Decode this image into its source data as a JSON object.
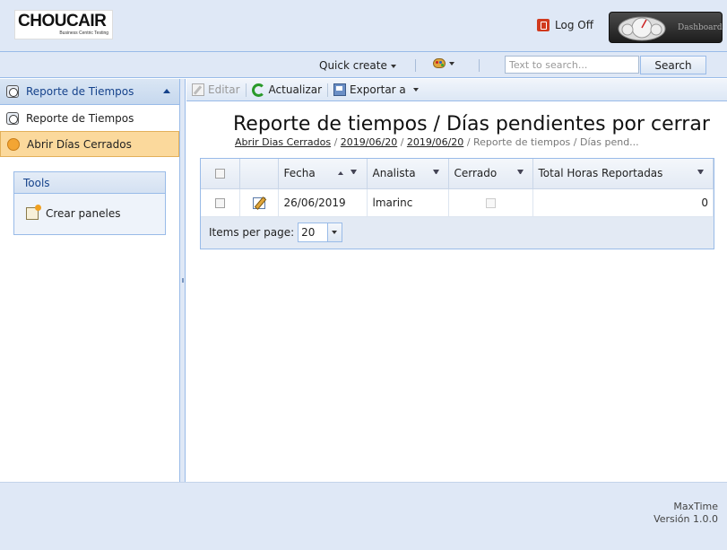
{
  "header": {
    "logo_text": "CHOUCAIR",
    "logo_tagline": "Business Centric Testing",
    "logoff_label": "Log Off",
    "dashboard_label": "Dashboard"
  },
  "topbar": {
    "quick_create_label": "Quick create",
    "search_placeholder": "Text to search...",
    "search_button": "Search"
  },
  "sidebar": {
    "panel_title": "Reporte de Tiempos",
    "items": [
      {
        "label": "Reporte de Tiempos",
        "icon": "clock-icon",
        "active": false
      },
      {
        "label": "Abrir Días Cerrados",
        "icon": "star-icon",
        "active": true
      }
    ],
    "tools": {
      "title": "Tools",
      "items": [
        {
          "label": "Crear paneles",
          "icon": "panel-add-icon"
        }
      ]
    }
  },
  "toolbar": {
    "edit_label": "Editar",
    "refresh_label": "Actualizar",
    "export_label": "Exportar a"
  },
  "page": {
    "title": "Reporte de tiempos / Días pendientes por cerrar",
    "breadcrumb": [
      {
        "label": "Abrir Dias Cerrados",
        "link": true
      },
      {
        "label": "2019/06/20",
        "link": true
      },
      {
        "label": "2019/06/20",
        "link": true
      },
      {
        "label": "Reporte de tiempos / Días pend...",
        "link": false
      }
    ]
  },
  "grid": {
    "columns": [
      "",
      "",
      "Fecha",
      "Analista",
      "Cerrado",
      "Total Horas Reportadas"
    ],
    "rows": [
      {
        "fecha": "26/06/2019",
        "analista": "lmarinc",
        "cerrado": false,
        "total_horas": "0"
      }
    ],
    "items_per_page_label": "Items per page:",
    "items_per_page_value": "20"
  },
  "footer": {
    "app_name": "MaxTime",
    "version": "Versión 1.0.0"
  },
  "colors": {
    "accent": "#99bbe8",
    "header_bg": "#dfe8f6",
    "active_nav": "#fbd99c"
  }
}
